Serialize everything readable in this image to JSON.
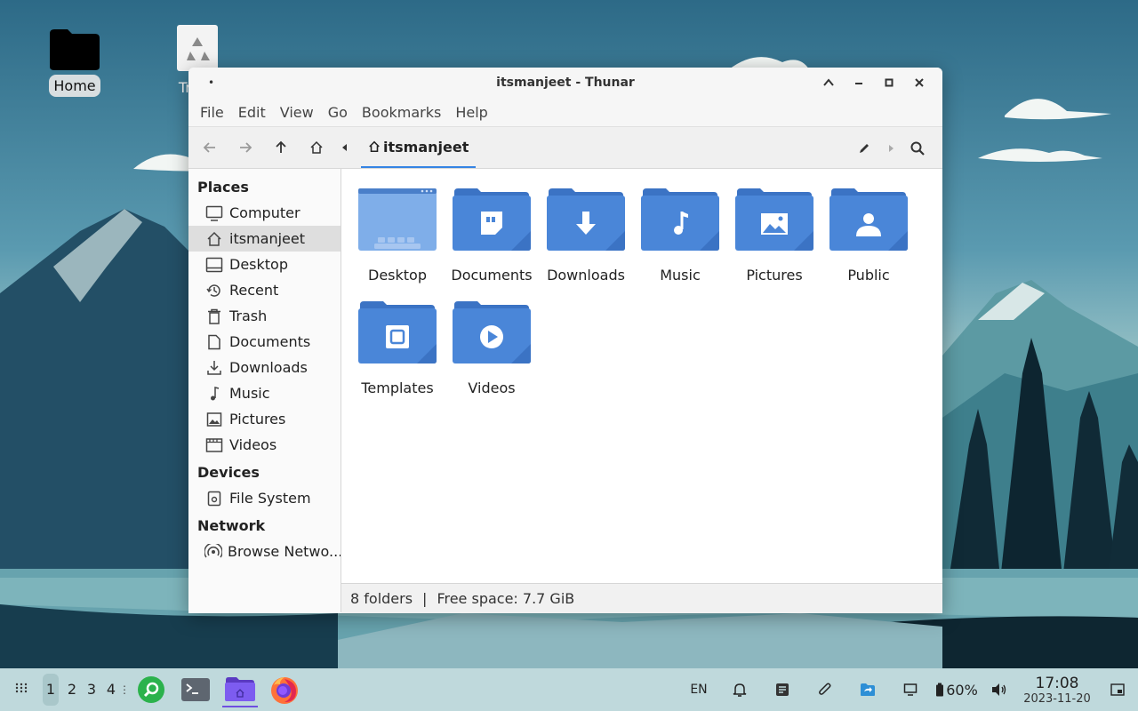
{
  "desktop": {
    "icons": [
      {
        "label": "Home"
      },
      {
        "label": "Trash"
      }
    ]
  },
  "window": {
    "title": "itsmanjeet - Thunar",
    "menu": [
      "File",
      "Edit",
      "View",
      "Go",
      "Bookmarks",
      "Help"
    ],
    "location": "itsmanjeet",
    "sidebar": {
      "places_heading": "Places",
      "places": [
        "Computer",
        "itsmanjeet",
        "Desktop",
        "Recent",
        "Trash",
        "Documents",
        "Downloads",
        "Music",
        "Pictures",
        "Videos"
      ],
      "devices_heading": "Devices",
      "devices": [
        "File System"
      ],
      "network_heading": "Network",
      "network": [
        "Browse Netwo..."
      ]
    },
    "folders": [
      "Desktop",
      "Documents",
      "Downloads",
      "Music",
      "Pictures",
      "Public",
      "Templates",
      "Videos"
    ],
    "status": {
      "count": "8 folders",
      "separator": "|",
      "free": "Free space: 7.7 GiB"
    }
  },
  "panel": {
    "workspaces": [
      "1",
      "2",
      "3",
      "4"
    ],
    "lang": "EN",
    "battery": "60%",
    "time": "17:08",
    "date": "2023-11-20"
  },
  "colors": {
    "folder": "#4a86d8",
    "folder_dark": "#3b73c4",
    "accent": "#3584e4"
  }
}
